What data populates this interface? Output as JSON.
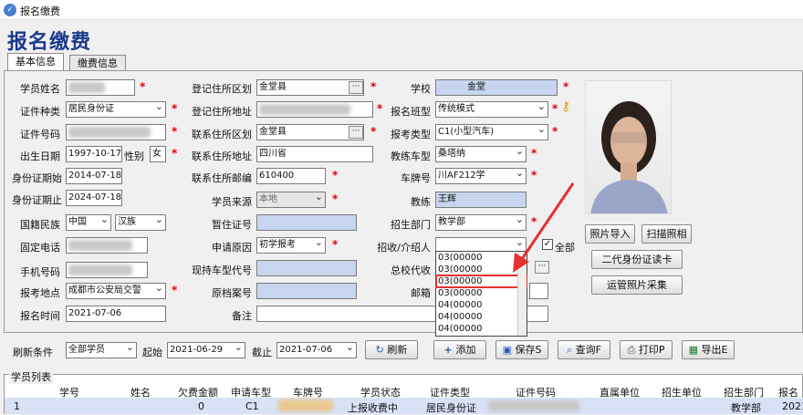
{
  "window": {
    "title": "报名缴费"
  },
  "header": {
    "title": "报名缴费"
  },
  "tabs": [
    {
      "label": "基本信息"
    },
    {
      "label": "缴费信息"
    }
  ],
  "form": {
    "name_label": "学员姓名",
    "id_type_label": "证件种类",
    "id_type_value": "居民身份证",
    "id_no_label": "证件号码",
    "birth_label": "出生日期",
    "birth_value": "1997-10-17",
    "gender_label": "性别",
    "gender_value": "女",
    "id_start_label": "身份证期始",
    "id_start_value": "2014-07-18",
    "id_end_label": "身份证期止",
    "id_end_value": "2024-07-18",
    "nation_label": "国籍民族",
    "nation_value": "中国",
    "ethnic_value": "汉族",
    "phone_label": "固定电话",
    "mobile_label": "手机号码",
    "loc_label": "报考地点",
    "loc_value": "成都市公安局交警",
    "time_label": "报名时间",
    "time_value": "2021-07-06",
    "reg_area_label": "登记住所区划",
    "reg_area_value": "金堂县",
    "reg_addr_label": "登记住所地址",
    "con_area_label": "联系住所区划",
    "con_area_value": "金堂县",
    "con_addr_label": "联系住所地址",
    "con_addr_value": "四川省",
    "zip_label": "联系住所邮编",
    "zip_value": "610400",
    "source_label": "学员来源",
    "source_value": "本地",
    "temp_label": "暂住证号",
    "reason_label": "申请原因",
    "reason_value": "初学报考",
    "lic_label": "现持车型代号",
    "file_label": "原档案号",
    "remark_label": "备注",
    "school_label": "学校",
    "school_value": "金堂",
    "class_label": "报名班型",
    "class_value": "传统模式",
    "type_label": "报考类型",
    "type_value": "C1(小型汽车)",
    "car_label": "教练车型",
    "car_value": "桑塔纳",
    "plate_label": "车牌号",
    "plate_value": "川AF212学",
    "coach_label": "教练",
    "coach_value": "王辉",
    "dept_label": "招生部门",
    "dept_value": "教学部",
    "recruit_label": "招收/介绍人",
    "all_label": "全部",
    "agent_label": "总校代收",
    "email_label": "邮箱"
  },
  "dropdown_items": [
    "03(00000",
    "03(00000",
    "03(00000",
    "03(00000",
    "04(00000",
    "04(00000",
    "04(00000"
  ],
  "photo_buttons": {
    "import": "照片导入",
    "scan": "扫描照相",
    "reader": "二代身份证读卡",
    "collect": "运管照片采集"
  },
  "toolbar": {
    "refresh_label": "刷新条件",
    "refresh_value": "全部学员",
    "start_label": "起始",
    "start_value": "2021-06-29",
    "end_label": "截止",
    "end_value": "2021-07-06",
    "refresh_btn": "刷新",
    "add": "添加",
    "save": "保存S",
    "query": "查询F",
    "print": "打印P",
    "export": "导出E"
  },
  "grid": {
    "title": "学员列表",
    "headers": [
      "学号",
      "姓名",
      "欠费金额",
      "申请车型",
      "车牌号",
      "学员状态",
      "证件类型",
      "证件号码",
      "直属单位",
      "招生单位",
      "招生部门",
      "报名"
    ],
    "row": {
      "no": "1",
      "owe": "0",
      "car": "C1",
      "status": "上报收费中",
      "idtype": "居民身份证",
      "dept": "教学部",
      "date": "2021-"
    }
  },
  "colors": {
    "heading": "#1a3b8c",
    "input_blue": "#c7d6ee",
    "required": "#dd0000",
    "arrow": "#e53030",
    "highlight": "#e53030"
  }
}
